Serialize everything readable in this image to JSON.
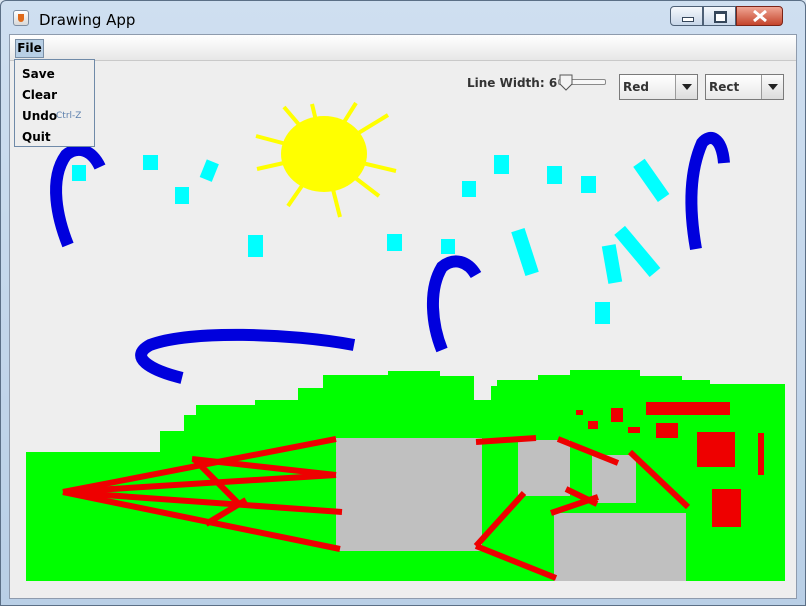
{
  "window": {
    "title": "Drawing App"
  },
  "menu": {
    "file_label": "File",
    "items": [
      {
        "label": "Save",
        "accelerator": ""
      },
      {
        "label": "Clear",
        "accelerator": ""
      },
      {
        "label": "Undo",
        "accelerator": "Ctrl-Z"
      },
      {
        "label": "Quit",
        "accelerator": ""
      }
    ]
  },
  "toolbar": {
    "line_width_label": "Line Width: 6",
    "line_width_value": 6,
    "color_selected": "Red",
    "shape_selected": "Rect"
  },
  "colors": {
    "sun": "#ffff00",
    "cyan": "#00ffff",
    "blue": "#0000dd",
    "green": "#00ff00",
    "gray": "#c0c0c0",
    "red": "#ee0000",
    "canvas_bg": "#eeeeee"
  },
  "icons": {
    "app": "java-cup-icon",
    "minimize": "minimize-icon",
    "maximize": "maximize-icon",
    "close": "close-icon",
    "dropdown": "chevron-down-icon"
  }
}
